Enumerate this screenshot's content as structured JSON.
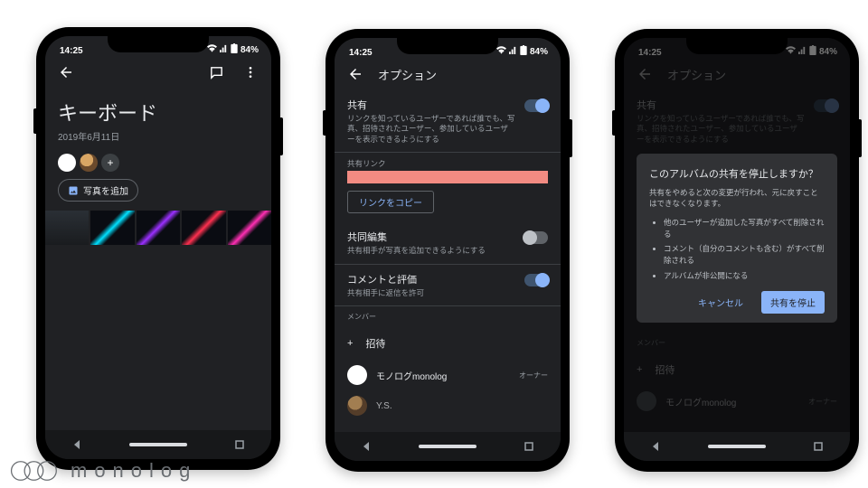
{
  "status": {
    "time": "14:25",
    "battery": "84%"
  },
  "brand": "monolog",
  "phone1": {
    "album_title": "キーボード",
    "album_date": "2019年6月11日",
    "add_photos": "写真を追加"
  },
  "phone2": {
    "screen_title": "オプション",
    "share": {
      "title": "共有",
      "sub": "リンクを知っているユーザーであれば誰でも、写真、招待されたユーザー、参加しているユーザーを表示できるようにする"
    },
    "share_link_label": "共有リンク",
    "copy_link": "リンクをコピー",
    "coedit": {
      "title": "共同編集",
      "sub": "共有相手が写真を追加できるようにする"
    },
    "comments": {
      "title": "コメントと評価",
      "sub": "共有相手に返信を許可"
    },
    "members_label": "メンバー",
    "invite": "招待",
    "member_name": "モノログmonolog",
    "owner": "オーナー",
    "member2": "Y.S."
  },
  "phone3": {
    "screen_title": "オプション",
    "share": {
      "title": "共有",
      "sub": "リンクを知っているユーザーであれば誰でも、写真、招待されたユーザー、参加しているユーザーを表示できるようにする"
    },
    "dialog": {
      "title": "このアルバムの共有を停止しますか？",
      "lead": "共有をやめると次の変更が行われ、元に戻すことはできなくなります。",
      "bullets": [
        "他のユーザーが追加した写真がすべて削除される",
        "コメント（自分のコメントも含む）がすべて削除される",
        "アルバムが非公開になる"
      ],
      "cancel": "キャンセル",
      "confirm": "共有を停止"
    },
    "members_label": "メンバー",
    "invite": "招待",
    "member_name": "モノログmonolog",
    "owner": "オーナー"
  }
}
